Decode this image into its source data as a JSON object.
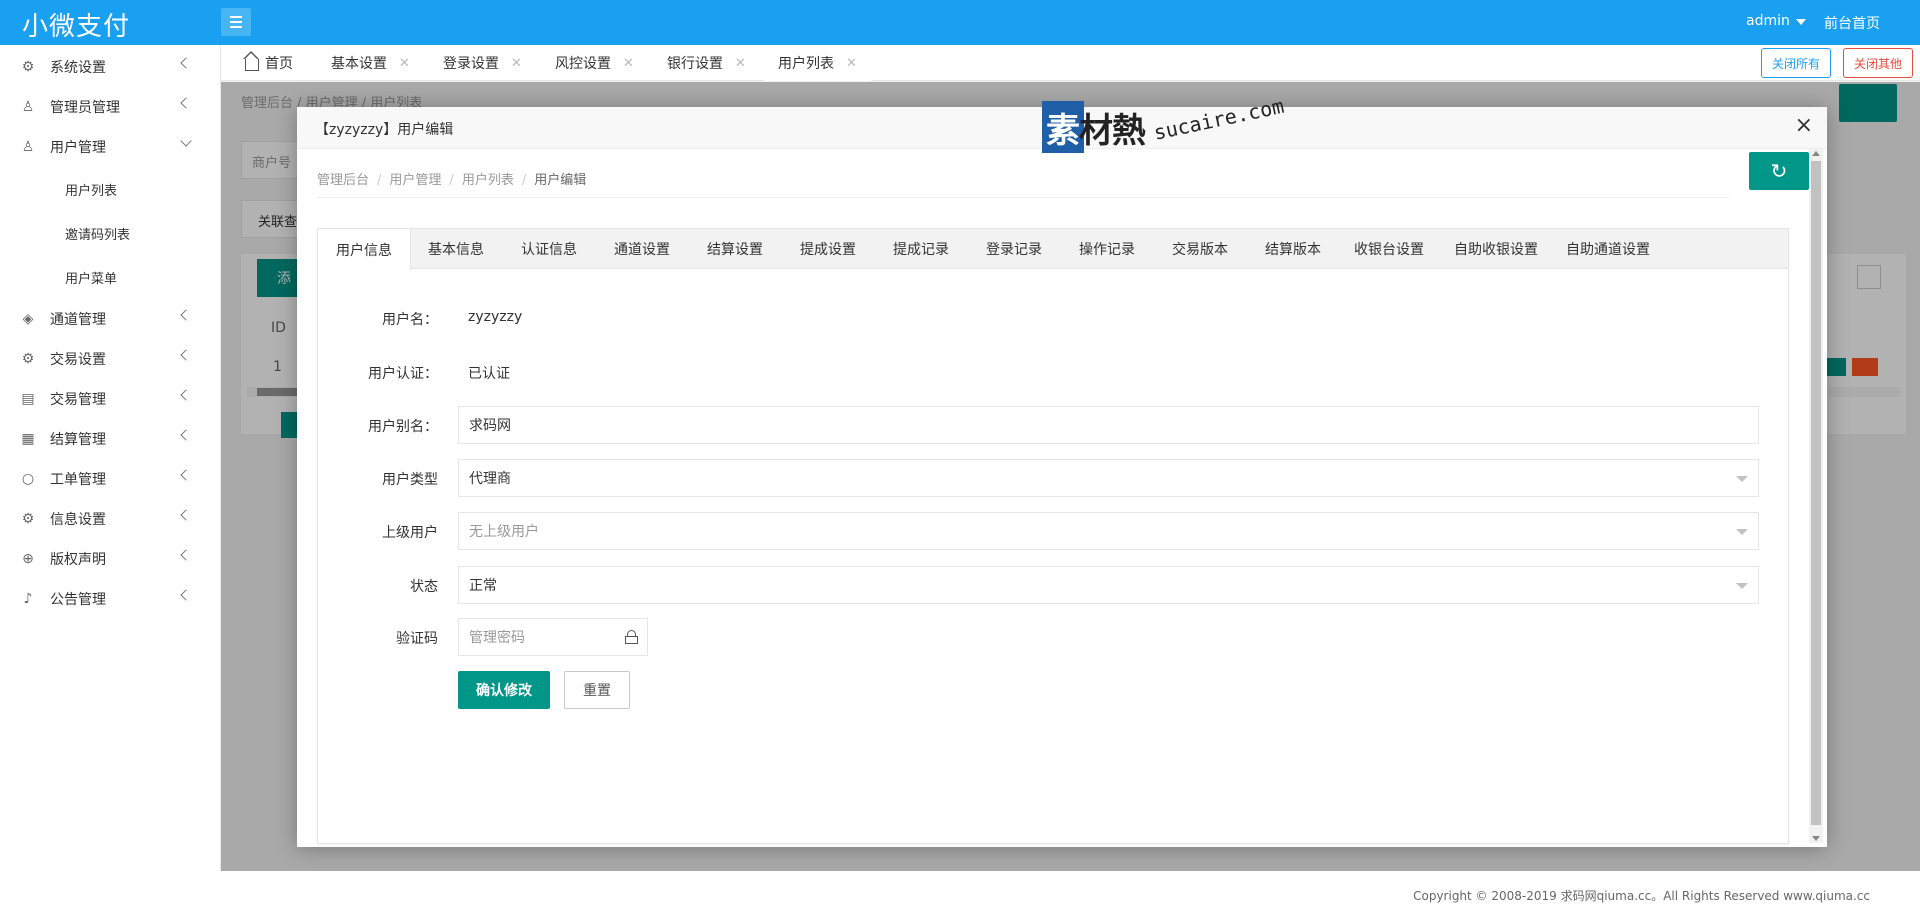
{
  "app": {
    "logo": "小微支付",
    "user": "admin",
    "front_link": "前台首页"
  },
  "sidebar": {
    "items": [
      {
        "label": "系统设置",
        "icon": "gear-icon"
      },
      {
        "label": "管理员管理",
        "icon": "user-icon"
      },
      {
        "label": "用户管理",
        "icon": "users-icon",
        "expanded": true,
        "children": [
          "用户列表",
          "邀请码列表",
          "用户菜单"
        ]
      },
      {
        "label": "通道管理",
        "icon": "cube-icon"
      },
      {
        "label": "交易设置",
        "icon": "gear-icon"
      },
      {
        "label": "交易管理",
        "icon": "clipboard-icon"
      },
      {
        "label": "结算管理",
        "icon": "calendar-icon"
      },
      {
        "label": "工单管理",
        "icon": "circle-icon"
      },
      {
        "label": "信息设置",
        "icon": "gear-icon"
      },
      {
        "label": "版权声明",
        "icon": "plus-circle-icon"
      },
      {
        "label": "公告管理",
        "icon": "bell-icon"
      }
    ]
  },
  "tabs": {
    "home": "首页",
    "items": [
      "基本设置",
      "登录设置",
      "风控设置",
      "银行设置",
      "用户列表"
    ],
    "active": "用户列表",
    "close_all": "关闭所有",
    "close_others": "关闭其他"
  },
  "background": {
    "breadcrumb": "管理后台  /  用户管理  /  用户列表",
    "search_placeholder": "商户号",
    "assoc_button": "关联查",
    "add_button": "添",
    "col_id": "ID",
    "row_id": "1"
  },
  "modal": {
    "title": "【zyzyzzy】用户编辑",
    "close": "×",
    "breadcrumb": [
      "管理后台",
      "用户管理",
      "用户列表",
      "用户编辑"
    ],
    "tabs": [
      "用户信息",
      "基本信息",
      "认证信息",
      "通道设置",
      "结算设置",
      "提成设置",
      "提成记录",
      "登录记录",
      "操作记录",
      "交易版本",
      "结算版本",
      "收银台设置",
      "自助收银设置",
      "自助通道设置"
    ],
    "active_tab": "用户信息",
    "form": {
      "username_label": "用户名：",
      "username_value": "zyzyzzy",
      "auth_label": "用户认证：",
      "auth_value": "已认证",
      "alias_label": "用户别名：",
      "alias_value": "求码网",
      "type_label": "用户类型",
      "type_value": "代理商",
      "parent_label": "上级用户",
      "parent_value": "无上级用户",
      "status_label": "状态",
      "status_value": "正常",
      "captcha_label": "验证码",
      "captcha_placeholder": "管理密码",
      "submit": "确认修改",
      "reset": "重置"
    }
  },
  "watermark": {
    "zh": "素材熱",
    "en": "sucaire.com"
  },
  "footer": {
    "copyright": "Copyright © 2008-2019 求码网qiuma.cc。All Rights Reserved www.qiuma.cc"
  },
  "colors": {
    "header": "#1aa0f0",
    "primary": "#009688",
    "danger": "#e84c3d"
  }
}
